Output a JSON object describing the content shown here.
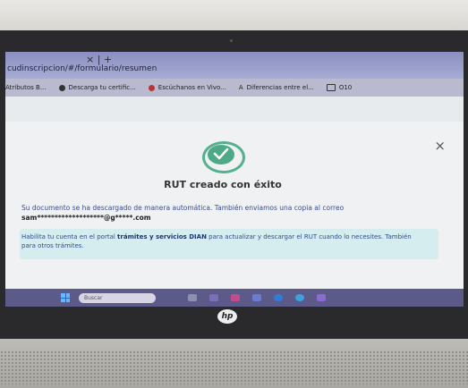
{
  "browser": {
    "tab_close": "× | +",
    "url": "cudinscripcion/#/formulario/resumen",
    "bookmarks": [
      {
        "label": "Atributos B...",
        "icon": "none"
      },
      {
        "label": "Descarga tu certific...",
        "icon": "globe-icon"
      },
      {
        "label": "Escúchanos en Vivo...",
        "icon": "radio-icon"
      },
      {
        "label": "Diferencias entre el...",
        "icon": "letter-a-icon"
      },
      {
        "label": "O10",
        "icon": "folder-icon"
      }
    ]
  },
  "modal": {
    "close": "×",
    "title": "RUT creado con éxito",
    "message": "Su documento se ha descargado de manera automática. También enviamos una copia al correo",
    "email": "sam*******************@g*****.com",
    "info_prefix": "Habilita tu cuenta en el portal ",
    "info_link": "trámites y servicios DIAN",
    "info_suffix": " para actualizar y descargar el RUT cuando lo necesites. También para otros trámites."
  },
  "taskbar": {
    "search_placeholder": "Buscar"
  },
  "device": {
    "brand": "hp"
  },
  "colors": {
    "accent_green": "#4fa888",
    "taskbar": "#5c5a88",
    "link_blue": "#2f4c86"
  }
}
